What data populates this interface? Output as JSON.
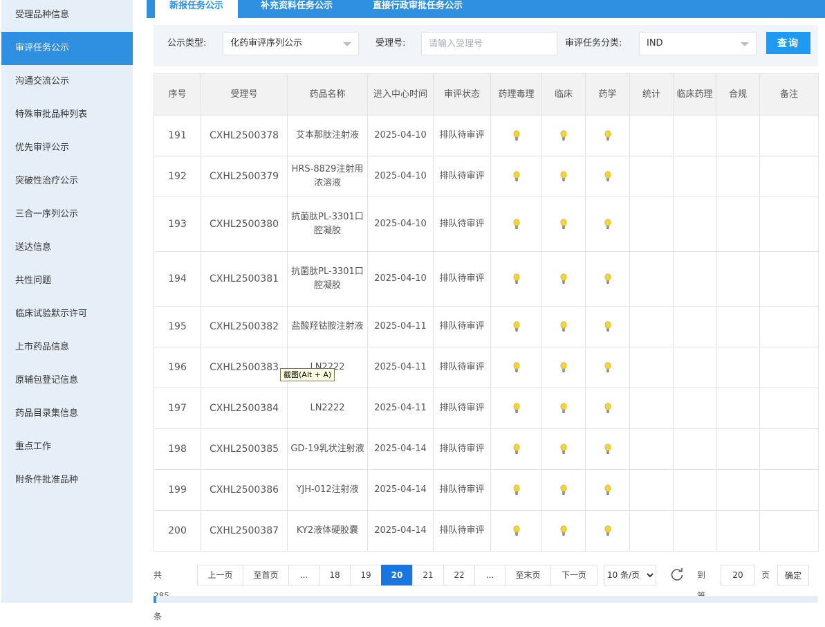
{
  "sidebar": {
    "items": [
      {
        "label": "受理品种信息",
        "active": false
      },
      {
        "label": "审评任务公示",
        "active": true
      },
      {
        "label": "沟通交流公示",
        "active": false
      },
      {
        "label": "特殊审批品种列表",
        "active": false
      },
      {
        "label": "优先审评公示",
        "active": false
      },
      {
        "label": "突破性治疗公示",
        "active": false
      },
      {
        "label": "三合一序列公示",
        "active": false
      },
      {
        "label": "送达信息",
        "active": false
      },
      {
        "label": "共性问题",
        "active": false
      },
      {
        "label": "临床试验默示许可",
        "active": false
      },
      {
        "label": "上市药品信息",
        "active": false
      },
      {
        "label": "原辅包登记信息",
        "active": false
      },
      {
        "label": "药品目录集信息",
        "active": false
      },
      {
        "label": "重点工作",
        "active": false
      },
      {
        "label": "附条件批准品种",
        "active": false
      }
    ]
  },
  "tabs": [
    {
      "label": "新报任务公示",
      "active": true
    },
    {
      "label": "补充资料任务公示",
      "active": false
    },
    {
      "label": "直接行政审批任务公示",
      "active": false
    }
  ],
  "filter": {
    "type_label": "公示类型:",
    "type_value": "化药审评序列公示",
    "accept_label": "受理号:",
    "accept_placeholder": "请输入受理号",
    "category_label": "审评任务分类:",
    "category_value": "IND",
    "query_label": "查询"
  },
  "table": {
    "headers": [
      "序号",
      "受理号",
      "药品名称",
      "进入中心时间",
      "审评状态",
      "药理毒理",
      "临床",
      "药学",
      "统计",
      "临床药理",
      "合规",
      "备注"
    ],
    "rows": [
      {
        "no": "191",
        "accept": "CXHL2500378",
        "name": "艾本那肽注射液",
        "time": "2025-04-10",
        "status": "排队待审评"
      },
      {
        "no": "192",
        "accept": "CXHL2500379",
        "name": "HRS-8829注射用浓溶液",
        "time": "2025-04-10",
        "status": "排队待审评"
      },
      {
        "no": "193",
        "accept": "CXHL2500380",
        "name": "抗菌肽PL-3301口腔凝胶",
        "time": "2025-04-10",
        "status": "排队待审评"
      },
      {
        "no": "194",
        "accept": "CXHL2500381",
        "name": "抗菌肽PL-3301口腔凝胶",
        "time": "2025-04-10",
        "status": "排队待审评"
      },
      {
        "no": "195",
        "accept": "CXHL2500382",
        "name": "盐酸羟钴胺注射液",
        "time": "2025-04-11",
        "status": "排队待审评"
      },
      {
        "no": "196",
        "accept": "CXHL2500383",
        "name": "LN2222",
        "time": "2025-04-11",
        "status": "排队待审评"
      },
      {
        "no": "197",
        "accept": "CXHL2500384",
        "name": "LN2222",
        "time": "2025-04-11",
        "status": "排队待审评"
      },
      {
        "no": "198",
        "accept": "CXHL2500385",
        "name": "GD-19乳状注射液",
        "time": "2025-04-14",
        "status": "排队待审评"
      },
      {
        "no": "199",
        "accept": "CXHL2500386",
        "name": "YJH-012注射液",
        "time": "2025-04-14",
        "status": "排队待审评"
      },
      {
        "no": "200",
        "accept": "CXHL2500387",
        "name": "KY2液体硬胶囊",
        "time": "2025-04-14",
        "status": "排队待审评"
      }
    ]
  },
  "pager": {
    "total": "共 285 条",
    "prev": "上一页",
    "first": "至首页",
    "ellipsis": "...",
    "pages": [
      "18",
      "19",
      "20",
      "21",
      "22"
    ],
    "current": "20",
    "last": "至末页",
    "next": "下一页",
    "page_size": "10 条/页",
    "goto_label": "到第",
    "goto_value": "20",
    "page_unit": "页",
    "confirm": "确定"
  },
  "tooltip": "截图(Alt + A)",
  "colors": {
    "accent": "#2f8fe0",
    "query_button": "#1e9bf0",
    "current_page": "#1976e0",
    "sidebar_bg": "#e6eef8",
    "bulb": "#f2d33a"
  },
  "icons": {
    "review_status": "lightbulb-icon",
    "refresh": "refresh-icon",
    "select": "chevron-down-icon"
  }
}
